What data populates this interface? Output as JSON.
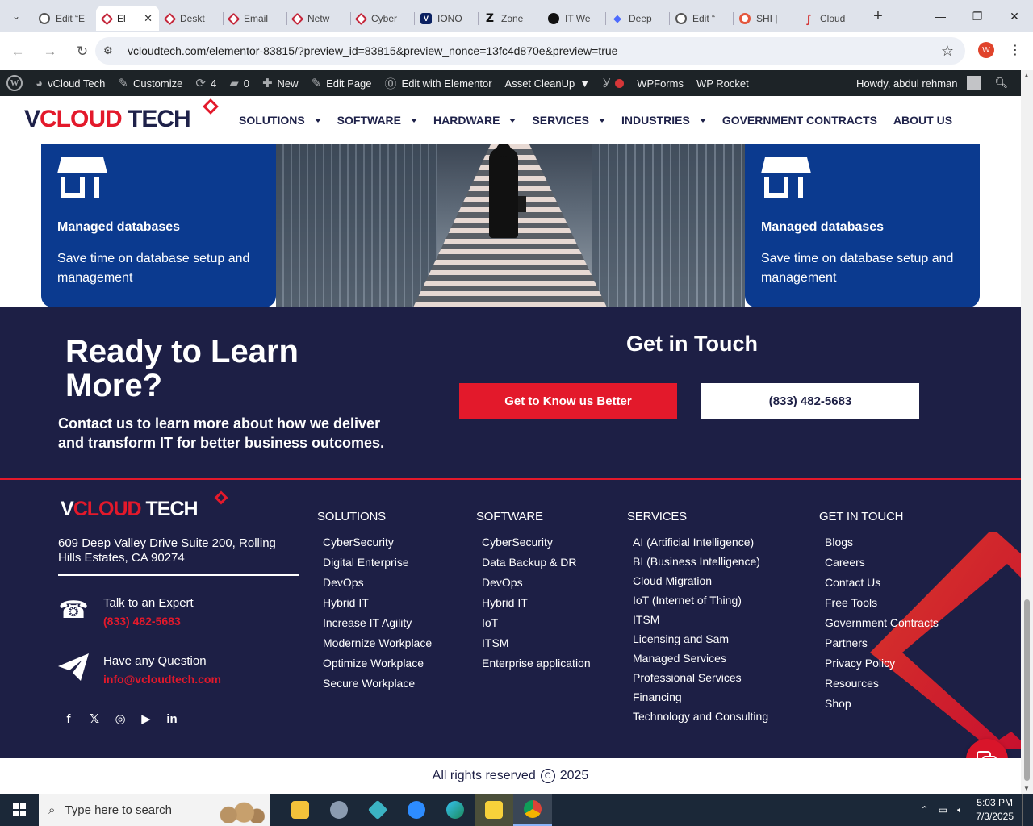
{
  "browser": {
    "tabs": [
      {
        "label": "Edit “E",
        "icon": "globe-icon",
        "active": false
      },
      {
        "label": "El",
        "icon": "elementor-icon",
        "active": true
      },
      {
        "label": "Deskt",
        "icon": "elementor-icon",
        "active": false
      },
      {
        "label": "Email",
        "icon": "elementor-icon",
        "active": false
      },
      {
        "label": "Netw",
        "icon": "elementor-icon",
        "active": false
      },
      {
        "label": "Cyber",
        "icon": "elementor-icon",
        "active": false
      },
      {
        "label": "IONO",
        "icon": "v-icon",
        "active": false
      },
      {
        "label": "Zone",
        "icon": "z-icon",
        "active": false
      },
      {
        "label": "IT We",
        "icon": "openai-icon",
        "active": false
      },
      {
        "label": "Deep",
        "icon": "deepseek-icon",
        "active": false
      },
      {
        "label": "Edit “",
        "icon": "globe-icon",
        "active": false
      },
      {
        "label": "SHI |",
        "icon": "shi-icon",
        "active": false
      },
      {
        "label": "Cloud",
        "icon": "cloud-brand-icon",
        "active": false
      }
    ],
    "url": "vcloudtech.com/elementor-83815/?preview_id=83815&preview_nonce=13fc4d870e&preview=true",
    "profile_initial": "W"
  },
  "adminbar": {
    "site_name": "vCloud Tech",
    "customize": "Customize",
    "updates_count": "4",
    "comments_count": "0",
    "new": "New",
    "edit_page": "Edit Page",
    "edit_elementor": "Edit with Elementor",
    "asset_cleanup": "Asset CleanUp",
    "wpforms": "WPForms",
    "wp_rocket": "WP Rocket",
    "howdy": "Howdy, abdul rehman"
  },
  "header": {
    "logo_v": "V",
    "logo_cloud": "CLOUD",
    "logo_tech": " TECH",
    "nav": [
      {
        "label": "SOLUTIONS",
        "dropdown": true
      },
      {
        "label": "SOFTWARE",
        "dropdown": true
      },
      {
        "label": "HARDWARE",
        "dropdown": true
      },
      {
        "label": "SERVICES",
        "dropdown": true
      },
      {
        "label": "INDUSTRIES",
        "dropdown": true
      },
      {
        "label": "GOVERNMENT CONTRACTS",
        "dropdown": false
      },
      {
        "label": "ABOUT US",
        "dropdown": false
      }
    ]
  },
  "features": {
    "left": {
      "title": "Managed databases",
      "text": "Save time on database setup and management"
    },
    "right": {
      "title": "Managed databases",
      "text": "Save time on database setup and management"
    }
  },
  "cta": {
    "heading": "Ready to Learn More?",
    "text": "Contact us to learn more about how we deliver and transform IT for better business outcomes.",
    "touch_heading": "Get in Touch",
    "primary_button": "Get to Know us Better",
    "phone_button": "(833) 482-5683"
  },
  "footer": {
    "address": "609 Deep Valley Drive Suite 200, Rolling Hills Estates, CA 90274",
    "talk_label": "Talk to an Expert",
    "talk_value": "(833) 482-5683",
    "question_label": "Have any Question",
    "question_value": "info@vcloudtech.com",
    "socials": [
      "facebook-icon",
      "x-icon",
      "instagram-icon",
      "youtube-icon",
      "linkedin-icon"
    ],
    "solutions": {
      "heading": "SOLUTIONS",
      "items": [
        "CyberSecurity",
        "Digital Enterprise",
        "DevOps",
        "Hybrid IT",
        "Increase IT Agility",
        "Modernize Workplace",
        "Optimize Workplace",
        "Secure Workplace"
      ]
    },
    "software": {
      "heading": "SOFTWARE",
      "items": [
        "CyberSecurity",
        "Data Backup & DR",
        "DevOps",
        "Hybrid IT",
        "IoT",
        "ITSM",
        "Enterprise application"
      ]
    },
    "services": {
      "heading": "SERVICES",
      "items": [
        "AI (Artificial Intelligence)",
        "BI (Business Intelligence)",
        "Cloud Migration",
        "IoT (Internet of Thing)",
        "ITSM",
        "Licensing and Sam",
        "Managed Services",
        "Professional Services",
        "Financing",
        "Technology and Consulting"
      ]
    },
    "get_in_touch": {
      "heading": "GET IN TOUCH",
      "items": [
        "Blogs",
        "Careers",
        "Contact Us",
        "Free Tools",
        "Government Contracts",
        "Partners",
        "Privacy Policy",
        "Resources",
        "Shop"
      ]
    }
  },
  "copyright": {
    "text": "All rights reserved",
    "year": "2025"
  },
  "taskbar": {
    "search_placeholder": "Type here to search",
    "time": "5:03 PM",
    "date": "7/3/2025"
  },
  "colors": {
    "brand_red": "#e3192b",
    "navy": "#1d1f45",
    "feature_blue": "#0b3a8f",
    "admin_bar": "#1d2327"
  }
}
